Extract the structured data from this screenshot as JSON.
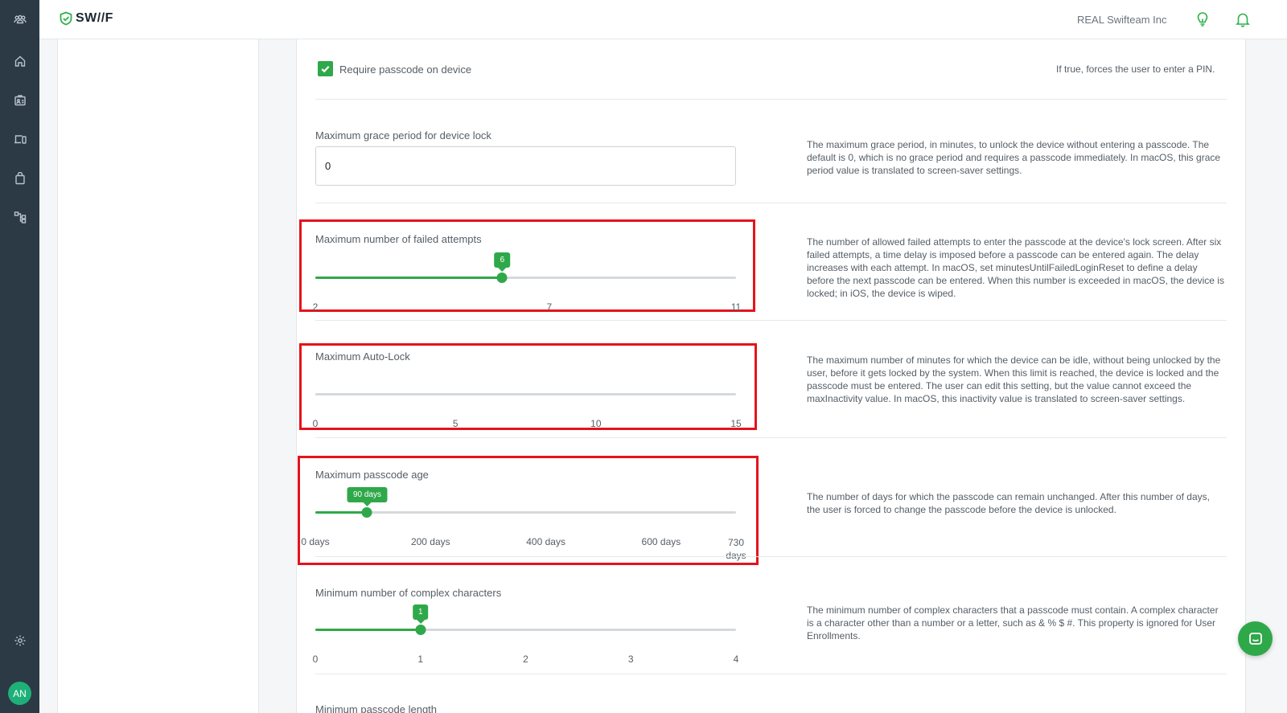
{
  "brand": {
    "logo_text": "SW//F",
    "accent": "#2fa84a"
  },
  "rail": {
    "items": [
      "team-icon",
      "home-icon",
      "users-icon",
      "devices-icon",
      "apps-icon",
      "workflow-icon",
      "settings-icon"
    ],
    "avatar": "AN"
  },
  "topbar": {
    "org_name": "REAL Swifteam Inc",
    "icons": [
      "lightbulb-icon",
      "bell-icon"
    ]
  },
  "settings": {
    "require_passcode": {
      "label": "Require passcode on device",
      "checked": true,
      "description": "If true, forces the user to enter a PIN."
    },
    "grace_period": {
      "label": "Maximum grace period for device lock",
      "value": "0",
      "description": "The maximum grace period, in minutes, to unlock the device without entering a passcode. The default is 0, which is no grace period and requires a passcode immediately. In macOS, this grace period value is translated to screen-saver settings."
    },
    "failed_attempts": {
      "label": "Maximum number of failed attempts",
      "min": 2,
      "max": 11,
      "value": 6,
      "value_label": "6",
      "ticks": [
        "2",
        "7",
        "11"
      ],
      "description": "The number of allowed failed attempts to enter the passcode at the device's lock screen. After six failed attempts, a time delay is imposed before a passcode can be entered again. The delay increases with each attempt. In macOS, set minutesUntilFailedLoginReset to define a delay before the next passcode can be entered. When this number is exceeded in macOS, the device is locked; in iOS, the device is wiped."
    },
    "auto_lock": {
      "label": "Maximum Auto-Lock",
      "min": 0,
      "max": 15,
      "ticks": [
        "0",
        "5",
        "10",
        "15"
      ],
      "description": "The maximum number of minutes for which the device can be idle, without being unlocked by the user, before it gets locked by the system. When this limit is reached, the device is locked and the passcode must be entered. The user can edit this setting, but the value cannot exceed the maxInactivity value. In macOS, this inactivity value is translated to screen-saver settings."
    },
    "passcode_age": {
      "label": "Maximum passcode age",
      "min": 0,
      "max": 730,
      "value": 90,
      "value_label": "90 days",
      "ticks": [
        "0 days",
        "200 days",
        "400 days",
        "600 days",
        "730 days"
      ],
      "description": "The number of days for which the passcode can remain unchanged. After this number of days, the user is forced to change the passcode before the device is unlocked."
    },
    "complex_chars": {
      "label": "Minimum number of complex characters",
      "min": 0,
      "max": 4,
      "value": 1,
      "value_label": "1",
      "ticks": [
        "0",
        "1",
        "2",
        "3",
        "4"
      ],
      "description": "The minimum number of complex characters that a passcode must contain. A complex character is a character other than a number or a letter, such as & % $ #. This property is ignored for User Enrollments."
    },
    "passcode_length": {
      "label": "Minimum passcode length"
    }
  }
}
